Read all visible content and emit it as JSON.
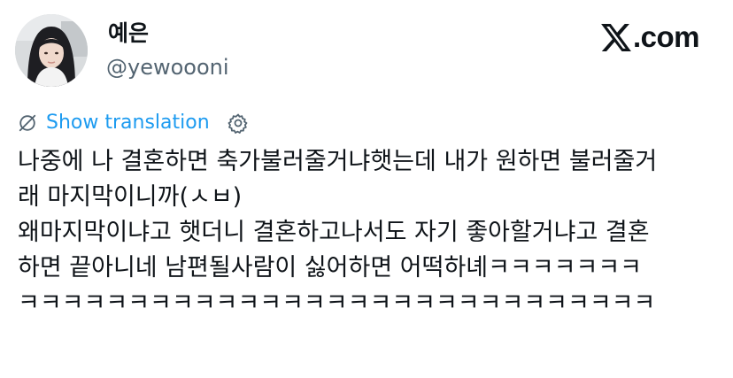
{
  "user": {
    "display_name": "예은",
    "handle": "@yewoooni"
  },
  "brand": {
    "logo_icon": "x-logo-icon",
    "text": ".com"
  },
  "translation": {
    "label": "Show translation",
    "globe_icon": "globe-icon",
    "settings_icon": "gear-icon"
  },
  "tweet": {
    "lines": [
      "나중에 나 결혼하면 축가불러줄거냐햇는데 내가 원하면 불러줄거",
      "래 마지막이니까(ㅅㅂ)",
      "왜마지막이냐고 햇더니 결혼하고나서도 자기 좋아할거냐고 결혼",
      "하면 끝아니네 남편될사람이 싫어하면 어떡하녜ㅋㅋㅋㅋㅋㅋㅋ",
      "ㅋㅋㅋㅋㅋㅋㅋㅋㅋㅋㅋㅋㅋㅋㅋㅋㅋㅋㅋㅋㅋㅋㅋㅋㅋㅋㅋㅋㅋ"
    ]
  },
  "colors": {
    "text": "#0f1419",
    "secondary": "#536471",
    "link": "#1d9bf0"
  }
}
